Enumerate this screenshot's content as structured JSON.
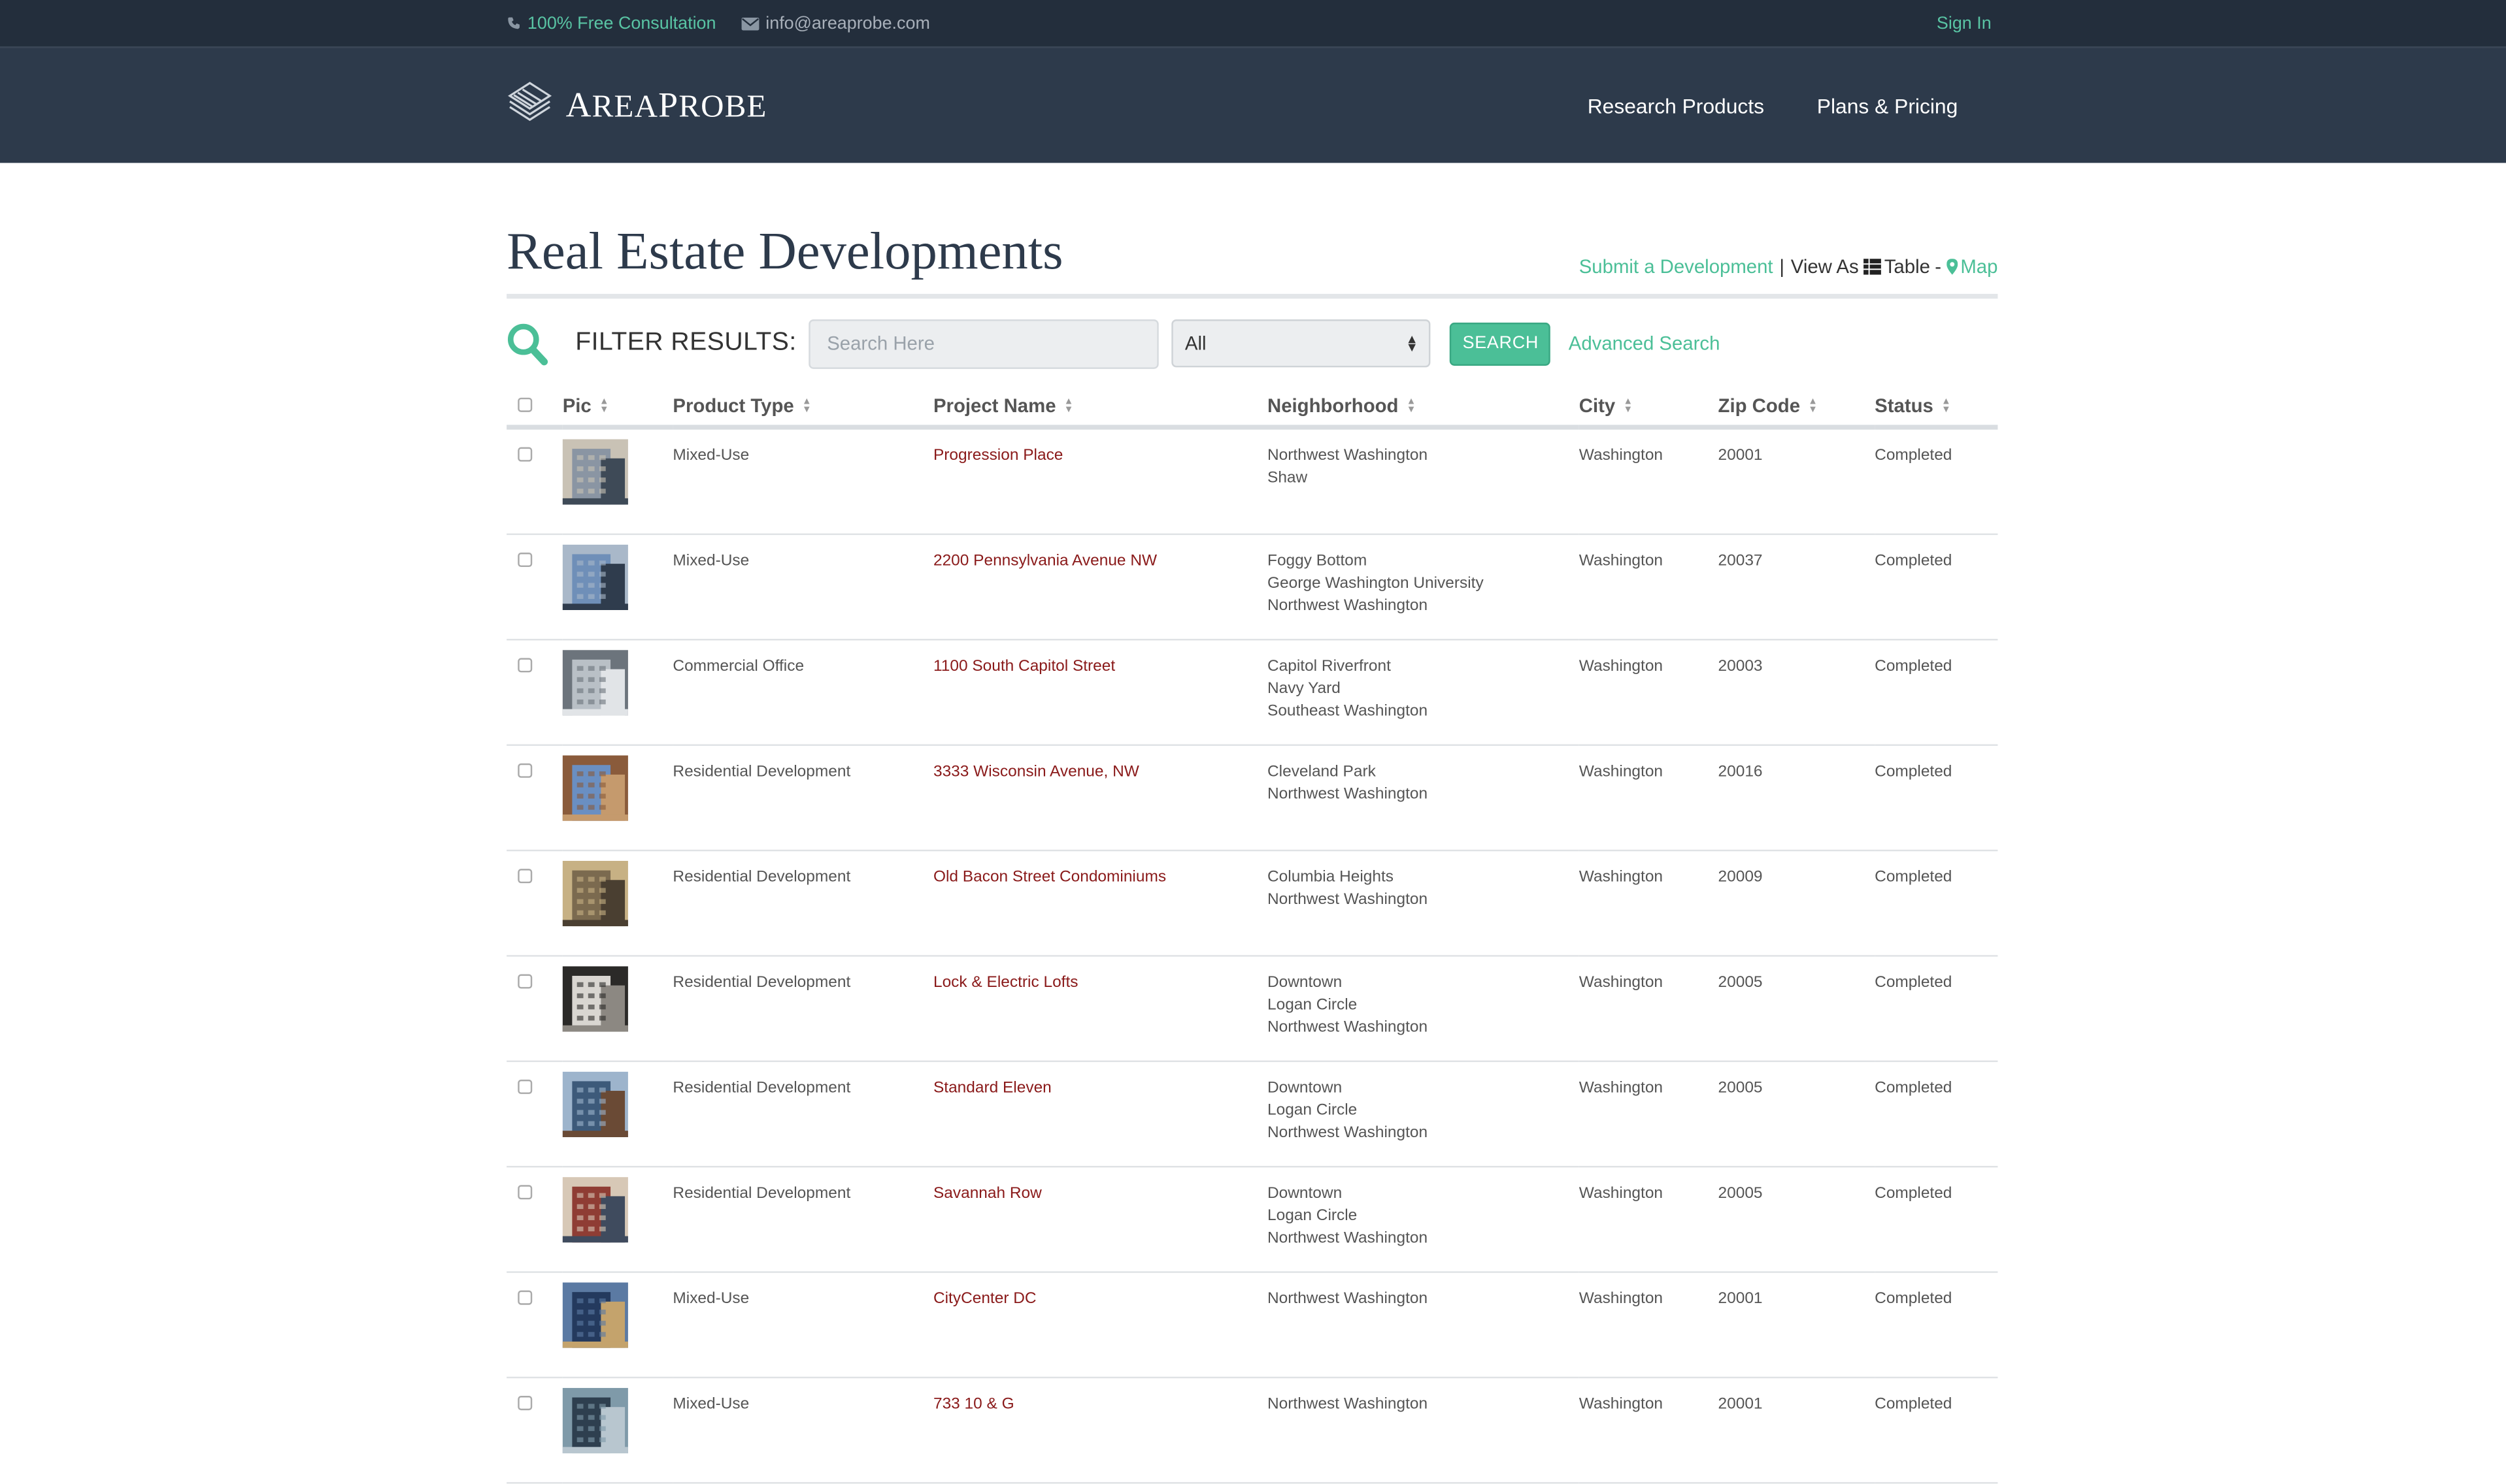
{
  "topbar": {
    "consultation": "100% Free Consultation",
    "email": "info@areaprobe.com",
    "signin": "Sign In"
  },
  "brand": {
    "name_first": "A",
    "name_rest_1": "REA",
    "name_second": "P",
    "name_rest_2": "ROBE"
  },
  "nav": {
    "research_products": "Research Products",
    "plans_pricing": "Plans & Pricing"
  },
  "page": {
    "title": "Real Estate Developments",
    "submit_link": "Submit a Development",
    "separator": "|",
    "view_as": "View As",
    "table_label": "Table",
    "dash": "-",
    "map_label": "Map"
  },
  "filter": {
    "label": "FILTER RESULTS:",
    "search_placeholder": "Search Here",
    "select_value": "All",
    "search_button": "SEARCH",
    "advanced_search": "Advanced Search"
  },
  "table": {
    "headers": {
      "pic": "Pic",
      "product_type": "Product Type",
      "project_name": "Project Name",
      "neighborhood": "Neighborhood",
      "city": "City",
      "zip": "Zip Code",
      "status": "Status"
    },
    "rows": [
      {
        "type": "Mixed-Use",
        "name": "Progression Place",
        "nb": [
          "Northwest Washington",
          "Shaw"
        ],
        "city": "Washington",
        "zip": "20001",
        "status": "Completed",
        "thumb": [
          "#8a95a3",
          "#c9c2b5",
          "#3e4a57"
        ]
      },
      {
        "type": "Mixed-Use",
        "name": "2200 Pennsylvania Avenue NW",
        "nb": [
          "Foggy Bottom",
          "George Washington University",
          "Northwest Washington"
        ],
        "city": "Washington",
        "zip": "20037",
        "status": "Completed",
        "thumb": [
          "#6f8fb8",
          "#a9b8c9",
          "#2f3c4d"
        ]
      },
      {
        "type": "Commercial Office",
        "name": "1100 South Capitol Street",
        "nb": [
          "Capitol Riverfront",
          "Navy Yard",
          "Southeast Washington"
        ],
        "city": "Washington",
        "zip": "20003",
        "status": "Completed",
        "thumb": [
          "#b9c0c6",
          "#6c747c",
          "#e1e4e7"
        ]
      },
      {
        "type": "Residential Development",
        "name": "3333 Wisconsin Avenue, NW",
        "nb": [
          "Cleveland Park",
          "Northwest Washington"
        ],
        "city": "Washington",
        "zip": "20016",
        "status": "Completed",
        "thumb": [
          "#6a8fc2",
          "#8a5b3b",
          "#c59a6d"
        ]
      },
      {
        "type": "Residential Development",
        "name": "Old Bacon Street Condominiums",
        "nb": [
          "Columbia Heights",
          "Northwest Washington"
        ],
        "city": "Washington",
        "zip": "20009",
        "status": "Completed",
        "thumb": [
          "#7b6a4f",
          "#c7b184",
          "#4a3f31"
        ]
      },
      {
        "type": "Residential Development",
        "name": "Lock & Electric Lofts",
        "nb": [
          "Downtown",
          "Logan Circle",
          "Northwest Washington"
        ],
        "city": "Washington",
        "zip": "20005",
        "status": "Completed",
        "thumb": [
          "#d9d6d1",
          "#2b2a28",
          "#8c8882"
        ]
      },
      {
        "type": "Residential Development",
        "name": "Standard Eleven",
        "nb": [
          "Downtown",
          "Logan Circle",
          "Northwest Washington"
        ],
        "city": "Washington",
        "zip": "20005",
        "status": "Completed",
        "thumb": [
          "#3d5a7a",
          "#9db4cc",
          "#6a4a35"
        ]
      },
      {
        "type": "Residential Development",
        "name": "Savannah Row",
        "nb": [
          "Downtown",
          "Logan Circle",
          "Northwest Washington"
        ],
        "city": "Washington",
        "zip": "20005",
        "status": "Completed",
        "thumb": [
          "#8f3d34",
          "#d7c8b6",
          "#3f4b5e"
        ]
      },
      {
        "type": "Mixed-Use",
        "name": "CityCenter DC",
        "nb": [
          "Northwest Washington"
        ],
        "city": "Washington",
        "zip": "20001",
        "status": "Completed",
        "thumb": [
          "#243a5e",
          "#5b7aa3",
          "#c4a36c"
        ]
      },
      {
        "type": "Mixed-Use",
        "name": "733 10 & G",
        "nb": [
          "Northwest Washington"
        ],
        "city": "Washington",
        "zip": "20001",
        "status": "Completed",
        "thumb": [
          "#2e3f4f",
          "#7f9aa9",
          "#b8c6cf"
        ]
      }
    ]
  },
  "colors": {
    "accent": "#4bbf97",
    "header_bg": "#2d3a4b",
    "topbar_bg": "#232e3c",
    "link_red": "#8a1a1a"
  }
}
